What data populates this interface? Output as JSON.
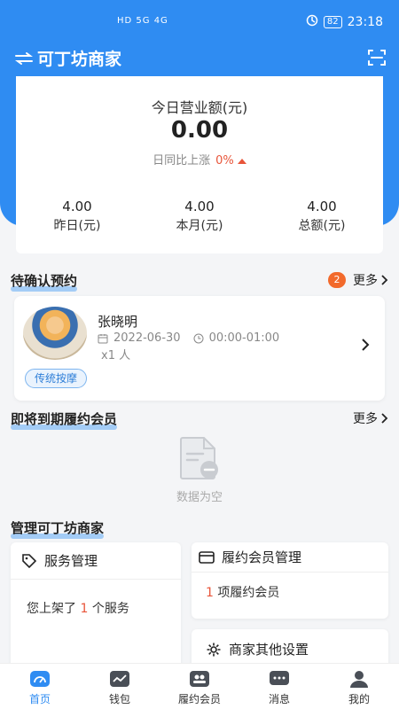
{
  "status_bar": {
    "network": "HD 5G 4G",
    "battery": "82",
    "time": "23:18"
  },
  "navbar": {
    "title": "可丁坊商家",
    "swap_icon": "swap-icon",
    "scan_icon": "scan-icon"
  },
  "revenue": {
    "title": "今日营业额(元)",
    "value": "0.00",
    "compare_label": "日同比上涨",
    "compare_pct": "0%",
    "stats": [
      {
        "value": "4.00",
        "label": "昨日(元)"
      },
      {
        "value": "4.00",
        "label": "本月(元)"
      },
      {
        "value": "4.00",
        "label": "总额(元)"
      }
    ]
  },
  "pending": {
    "title": "待确认预约",
    "badge": "2",
    "more": "更多",
    "item": {
      "name": "张晓明",
      "date": "2022-06-30",
      "time": "00:00-01:00",
      "qty": "x1 人",
      "tag": "传统按摩"
    }
  },
  "expiring": {
    "title": "即将到期履约会员",
    "more": "更多",
    "empty_text": "数据为空"
  },
  "manage": {
    "title": "管理可丁坊商家",
    "service": {
      "title": "服务管理",
      "text_before": "您上架了",
      "count": "1",
      "text_after": "个服务"
    },
    "membership": {
      "title": "履约会员管理",
      "count": "1",
      "text_after": "项履约会员"
    },
    "settings": {
      "title": "商家其他设置"
    }
  },
  "tabs": [
    {
      "label": "首页",
      "active": true
    },
    {
      "label": "钱包",
      "active": false
    },
    {
      "label": "履约会员",
      "active": false
    },
    {
      "label": "消息",
      "active": false
    },
    {
      "label": "我的",
      "active": false
    }
  ],
  "colors": {
    "primary": "#2f8cf2",
    "accent": "#e8553a",
    "badge": "#f26a2c"
  }
}
